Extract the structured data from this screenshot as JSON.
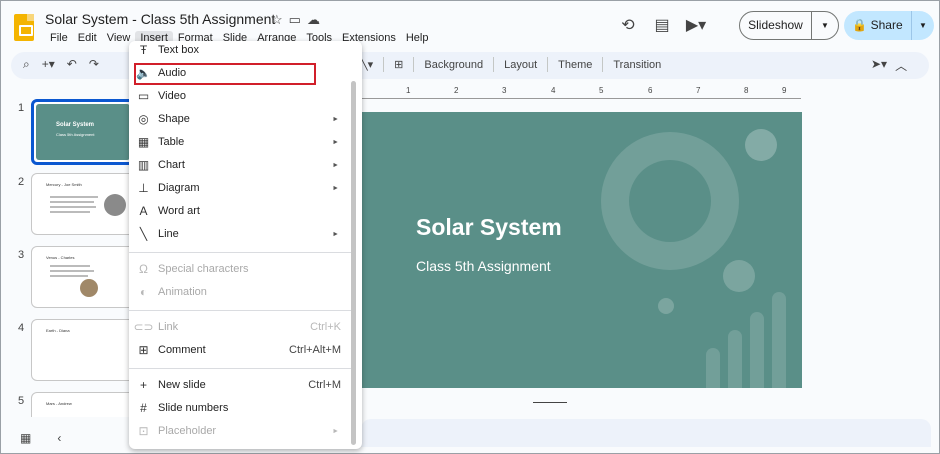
{
  "header": {
    "doc_title": "Solar System - Class  5th Assignment",
    "menus": [
      "File",
      "Edit",
      "View",
      "Insert",
      "Format",
      "Slide",
      "Arrange",
      "Tools",
      "Extensions",
      "Help"
    ],
    "active_menu": "Insert",
    "slideshow_label": "Slideshow",
    "share_label": "Share"
  },
  "toolbar": {
    "background": "Background",
    "layout": "Layout",
    "theme": "Theme",
    "transition": "Transition"
  },
  "ruler": {
    "numbers": [
      "1",
      "2",
      "3",
      "4",
      "5",
      "6",
      "7",
      "8",
      "9"
    ]
  },
  "filmstrip": {
    "numbers": [
      "1",
      "2",
      "3",
      "4",
      "5"
    ],
    "slide1": {
      "title": "Solar System",
      "subtitle": "Class 5th Assignment"
    },
    "slide2": {
      "title": "Mercury - Joe Smith"
    },
    "slide3": {
      "title": "Venus - Charles"
    },
    "slide4": {
      "title": "Earth - Diana"
    },
    "slide5": {
      "title": "Mars - Andrew"
    }
  },
  "slide": {
    "title": "Solar System",
    "subtitle": "Class 5th Assignment"
  },
  "insert_menu": {
    "text_box": "Text box",
    "audio": "Audio",
    "video": "Video",
    "shape": "Shape",
    "table": "Table",
    "chart": "Chart",
    "diagram": "Diagram",
    "word_art": "Word art",
    "line": "Line",
    "special_characters": "Special characters",
    "animation": "Animation",
    "link": "Link",
    "link_shortcut": "Ctrl+K",
    "comment": "Comment",
    "comment_shortcut": "Ctrl+Alt+M",
    "new_slide": "New slide",
    "new_slide_shortcut": "Ctrl+M",
    "slide_numbers": "Slide numbers",
    "placeholder": "Placeholder"
  },
  "colors": {
    "slide_bg": "#5a8f88",
    "accent": "#0b57d0",
    "share_bg": "#c2e7ff",
    "highlight": "#d11f2a"
  }
}
